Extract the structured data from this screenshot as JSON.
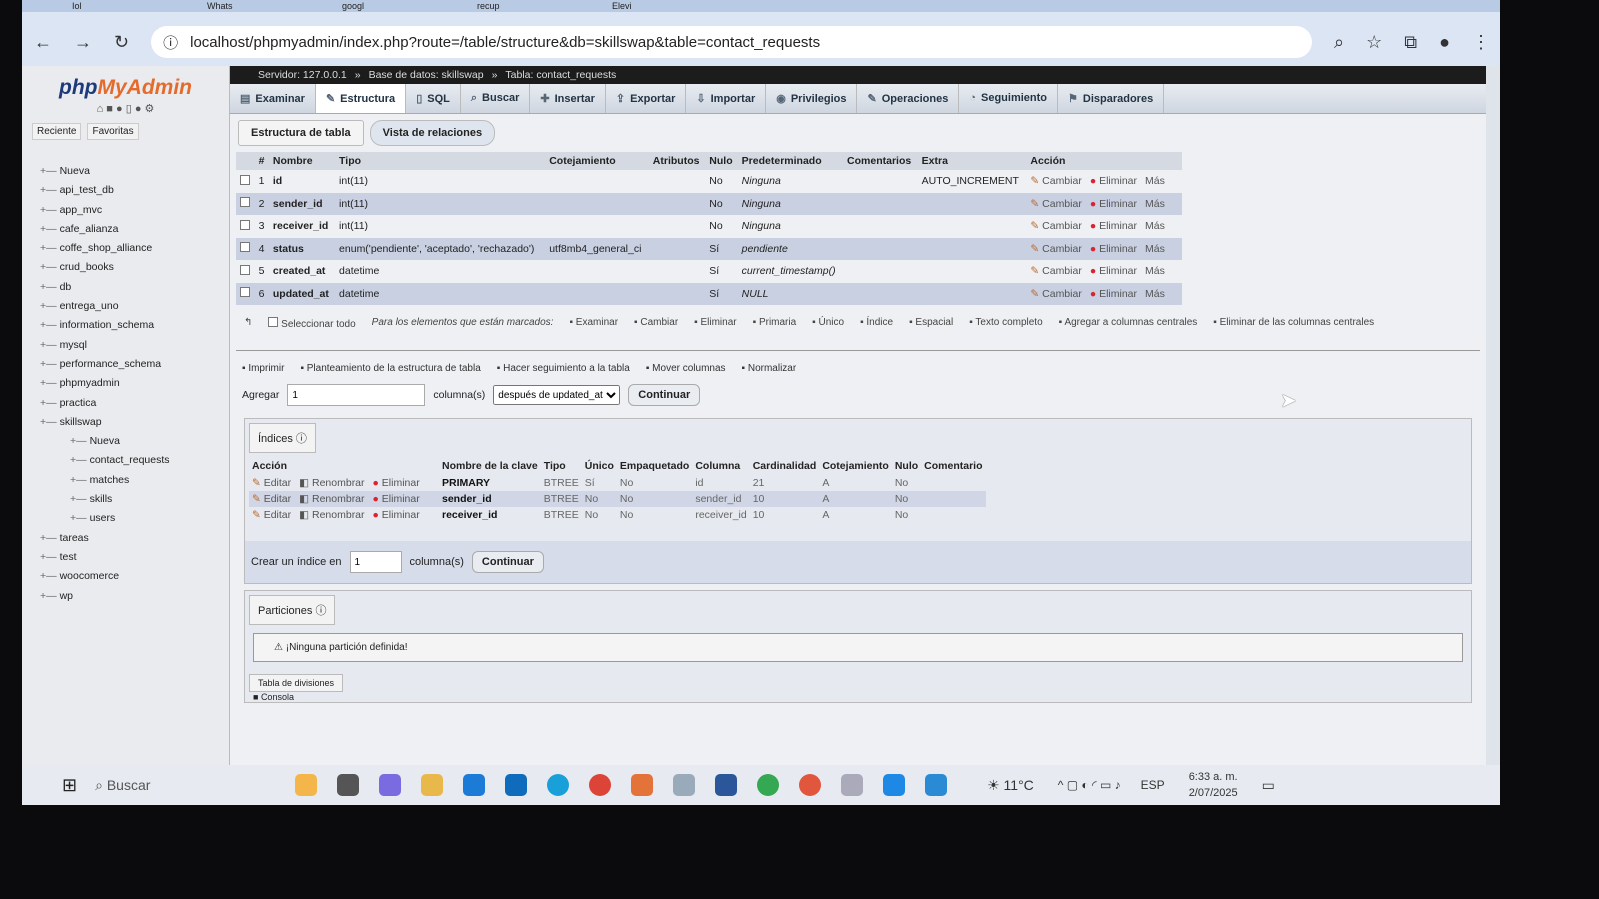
{
  "browser": {
    "tabs": [
      "Iol",
      "Whats",
      "googl",
      "recup",
      "Elevi"
    ],
    "url": "localhost/phpmyadmin/index.php?route=/table/structure&db=skillswap&table=contact_requests"
  },
  "sidebar": {
    "logo": "phpMyAdmin",
    "tabs": [
      "Reciente",
      "Favoritas"
    ],
    "tree": [
      "Nueva",
      "api_test_db",
      "app_mvc",
      "cafe_alianza",
      "coffe_shop_alliance",
      "crud_books",
      "db",
      "entrega_uno",
      "information_schema",
      "mysql",
      "performance_schema",
      "phpmyadmin",
      "practica",
      "skillswap"
    ],
    "skillswap_children": [
      "Nueva",
      "contact_requests",
      "matches",
      "skills",
      "users"
    ],
    "tree_after": [
      "tareas",
      "test",
      "woocomerce",
      "wp"
    ]
  },
  "breadcrumb": [
    "Servidor: 127.0.0.1",
    "Base de datos: skillswap",
    "Tabla: contact_requests"
  ],
  "topnav": [
    "Examinar",
    "Estructura",
    "SQL",
    "Buscar",
    "Insertar",
    "Exportar",
    "Importar",
    "Privilegios",
    "Operaciones",
    "Seguimiento",
    "Disparadores"
  ],
  "subtabs": [
    "Estructura de tabla",
    "Vista de relaciones"
  ],
  "structure": {
    "headers": [
      "#",
      "Nombre",
      "Tipo",
      "Cotejamiento",
      "Atributos",
      "Nulo",
      "Predeterminado",
      "Comentarios",
      "Extra",
      "Acción"
    ],
    "rows": [
      [
        "1",
        "id",
        "int(11)",
        "",
        "",
        "No",
        "Ninguna",
        "",
        "AUTO_INCREMENT"
      ],
      [
        "2",
        "sender_id",
        "int(11)",
        "",
        "",
        "No",
        "Ninguna",
        "",
        ""
      ],
      [
        "3",
        "receiver_id",
        "int(11)",
        "",
        "",
        "No",
        "Ninguna",
        "",
        ""
      ],
      [
        "4",
        "status",
        "enum('pendiente', 'aceptado', 'rechazado')",
        "utf8mb4_general_ci",
        "",
        "Sí",
        "pendiente",
        "",
        ""
      ],
      [
        "5",
        "created_at",
        "datetime",
        "",
        "",
        "Sí",
        "current_timestamp()",
        "",
        ""
      ],
      [
        "6",
        "updated_at",
        "datetime",
        "",
        "",
        "Sí",
        "NULL",
        "",
        ""
      ]
    ],
    "actions": [
      "Cambiar",
      "Eliminar",
      "Más"
    ]
  },
  "bulk": {
    "select_all": "Seleccionar todo",
    "marked": "Para los elementos que están marcados:",
    "items": [
      "Examinar",
      "Cambiar",
      "Eliminar",
      "Primaria",
      "Único",
      "Índice",
      "Espacial",
      "Texto completo",
      "Agregar a columnas centrales",
      "Eliminar de las columnas centrales"
    ]
  },
  "tools": [
    "Imprimir",
    "Planteamiento de la estructura de tabla",
    "Hacer seguimiento a la tabla",
    "Mover columnas",
    "Normalizar"
  ],
  "add": {
    "label": "Agregar",
    "value": "1",
    "unit": "columna(s)",
    "position": "después de updated_at",
    "button": "Continuar"
  },
  "indices": {
    "legend": "Índices",
    "headers": [
      "Acción",
      "Nombre de la clave",
      "Tipo",
      "Único",
      "Empaquetado",
      "Columna",
      "Cardinalidad",
      "Cotejamiento",
      "Nulo",
      "Comentario"
    ],
    "actions": [
      "Editar",
      "Renombrar",
      "Eliminar"
    ],
    "rows": [
      [
        "PRIMARY",
        "BTREE",
        "Sí",
        "No",
        "id",
        "21",
        "A",
        "No",
        ""
      ],
      [
        "sender_id",
        "BTREE",
        "No",
        "No",
        "sender_id",
        "10",
        "A",
        "No",
        ""
      ],
      [
        "receiver_id",
        "BTREE",
        "No",
        "No",
        "receiver_id",
        "10",
        "A",
        "No",
        ""
      ]
    ],
    "create_label": "Crear un índice en",
    "create_value": "1",
    "create_unit": "columna(s)",
    "create_button": "Continuar"
  },
  "partitions": {
    "legend": "Particiones",
    "message": "¡Ninguna partición definida!",
    "split": "Tabla de divisiones",
    "console": "Consola"
  },
  "taskbar": {
    "search": "Buscar",
    "weather": "11°C",
    "lang": "ESP",
    "time": "6:33 a. m.",
    "date": "2/07/2025"
  }
}
